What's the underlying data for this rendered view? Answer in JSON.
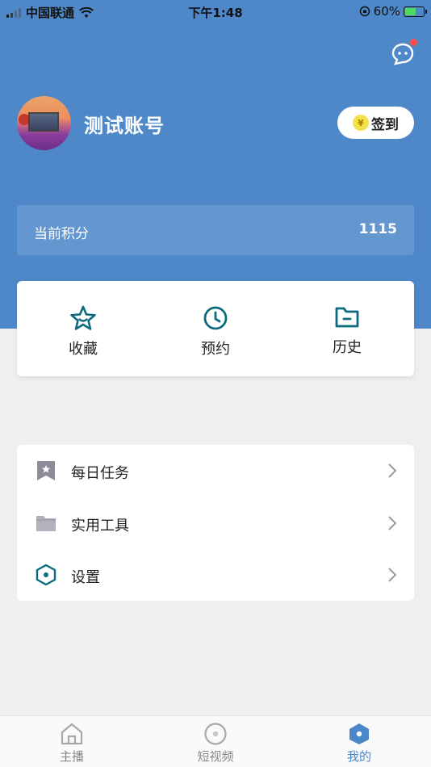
{
  "status_bar": {
    "carrier": "中国联通",
    "time": "下午1:48",
    "battery_percent": "60%",
    "battery_level": 0.6
  },
  "header": {
    "message_icon": "chat-bubble-icon",
    "has_notification": true
  },
  "profile": {
    "username": "测试账号",
    "signin_label": "签到",
    "coin_symbol": "¥"
  },
  "points": {
    "label": "当前积分",
    "value": "1115"
  },
  "quick_actions": [
    {
      "label": "收藏",
      "icon": "star-icon"
    },
    {
      "label": "预约",
      "icon": "clock-icon"
    },
    {
      "label": "历史",
      "icon": "folder-icon"
    }
  ],
  "menu": [
    {
      "label": "每日任务",
      "icon": "bookmark-star-icon"
    },
    {
      "label": "实用工具",
      "icon": "folder-icon"
    },
    {
      "label": "设置",
      "icon": "hexagon-settings-icon"
    }
  ],
  "tabs": [
    {
      "label": "主播",
      "icon": "home-icon",
      "active": false
    },
    {
      "label": "短视频",
      "icon": "disc-icon",
      "active": false
    },
    {
      "label": "我的",
      "icon": "hexagon-user-icon",
      "active": true
    }
  ],
  "colors": {
    "brand_blue": "#4e88c9",
    "teal_icon": "#0d6b7e",
    "badge_red": "#ff4d4f",
    "coin_yellow": "#f4e24a"
  }
}
